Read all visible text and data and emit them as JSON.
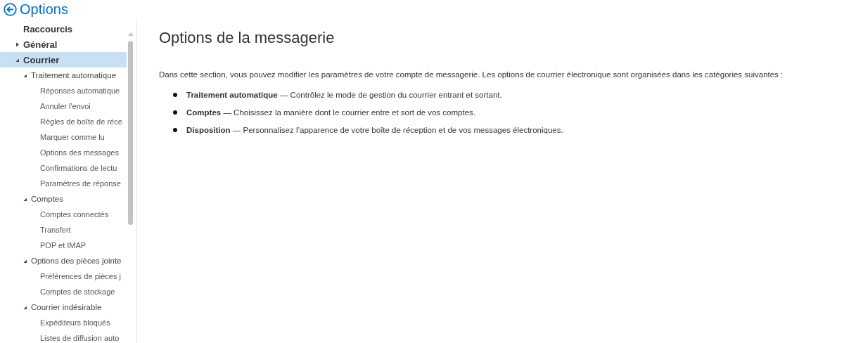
{
  "header": {
    "title": "Options"
  },
  "nav": [
    {
      "label": "Raccourcis",
      "selected": false
    },
    {
      "label": "Général",
      "selected": false,
      "expanded": false
    },
    {
      "label": "Courrier",
      "selected": true,
      "expanded": true,
      "children": [
        {
          "label": "Traitement automatique",
          "selected": false,
          "expanded": true,
          "children": [
            {
              "label": "Réponses automatique",
              "selected": false
            },
            {
              "label": "Annuler l'envoi",
              "selected": false
            },
            {
              "label": "Règles de boîte de réce",
              "selected": false
            },
            {
              "label": "Marquer comme lu",
              "selected": false
            },
            {
              "label": "Options des messages",
              "selected": false
            },
            {
              "label": "Confirmations de lectu",
              "selected": false
            },
            {
              "label": "Paramètres de réponse",
              "selected": false
            }
          ]
        },
        {
          "label": "Comptes",
          "selected": false,
          "expanded": true,
          "children": [
            {
              "label": "Comptes connectés",
              "selected": false
            },
            {
              "label": "Transfert",
              "selected": false
            },
            {
              "label": "POP et IMAP",
              "selected": false
            }
          ]
        },
        {
          "label": "Options des pièces jointe",
          "selected": false,
          "expanded": true,
          "children": [
            {
              "label": "Préférences de pièces j",
              "selected": false
            },
            {
              "label": "Comptes de stockage",
              "selected": false
            }
          ]
        },
        {
          "label": "Courrier indésirable",
          "selected": false,
          "expanded": true,
          "children": [
            {
              "label": "Expéditeurs bloqués",
              "selected": false
            },
            {
              "label": "Listes de diffusion auto",
              "selected": false
            }
          ]
        }
      ]
    }
  ],
  "main": {
    "heading": "Options de la messagerie",
    "intro": "Dans cette section, vous pouvez modifier les paramètres de votre compte de messagerie. Les options de courrier électronique sont organisées dans les catégories suivantes :",
    "bullets": [
      "**Traitement automatique** — Contrôlez le mode de gestion du courrier entrant et sortant.",
      "**Comptes** — Choisissez la manière dont le courrier entre et sort de vos comptes.",
      "**Disposition** — Personnalisez l’apparence de votre boîte de réception et de vos messages électroniques."
    ]
  }
}
